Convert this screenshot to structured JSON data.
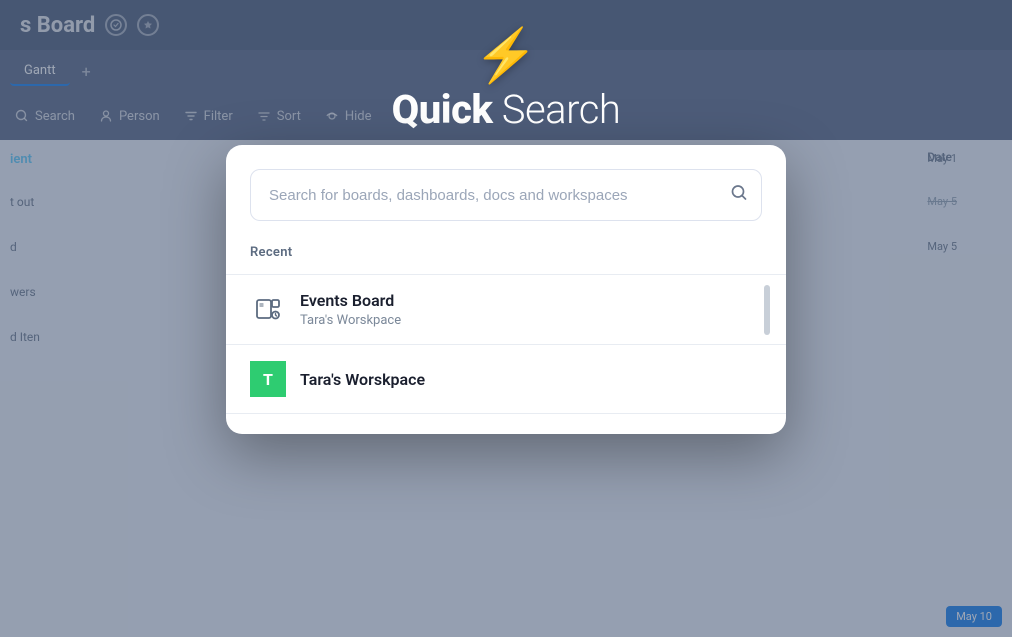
{
  "app": {
    "title": "s Board",
    "tabs": [
      {
        "label": "Gantt",
        "active": false
      },
      {
        "label": "+",
        "active": false
      }
    ],
    "filter_items": [
      {
        "label": "Search",
        "icon": "search"
      },
      {
        "label": "Person",
        "icon": "person"
      },
      {
        "label": "Filter",
        "icon": "filter"
      },
      {
        "label": "Sort",
        "icon": "sort"
      },
      {
        "label": "Hide",
        "icon": "hide"
      },
      {
        "label": "...",
        "icon": "more"
      }
    ],
    "col_header": "Date",
    "bg_rows": [
      {
        "label": "ient"
      },
      {
        "label": "t out"
      },
      {
        "label": "d"
      },
      {
        "label": "wers"
      },
      {
        "label": "d Iten"
      }
    ],
    "date_entries": [
      "May 1",
      "May-5",
      "May 5"
    ],
    "may_10_label": "May 10"
  },
  "dialog": {
    "lightning_emoji": "⚡",
    "title_bold": "Quick",
    "title_light": "Search",
    "search": {
      "placeholder": "Search for boards, dashboards, docs and workspaces",
      "icon": "🔍"
    },
    "recent_label": "Recent",
    "results": [
      {
        "type": "board",
        "icon_type": "board",
        "title": "Events Board",
        "subtitle": "Tara's Worskpace"
      },
      {
        "type": "workspace",
        "icon_type": "avatar",
        "avatar_letter": "T",
        "avatar_color": "#2ecc71",
        "title": "Tara's Worskpace",
        "subtitle": ""
      }
    ]
  }
}
